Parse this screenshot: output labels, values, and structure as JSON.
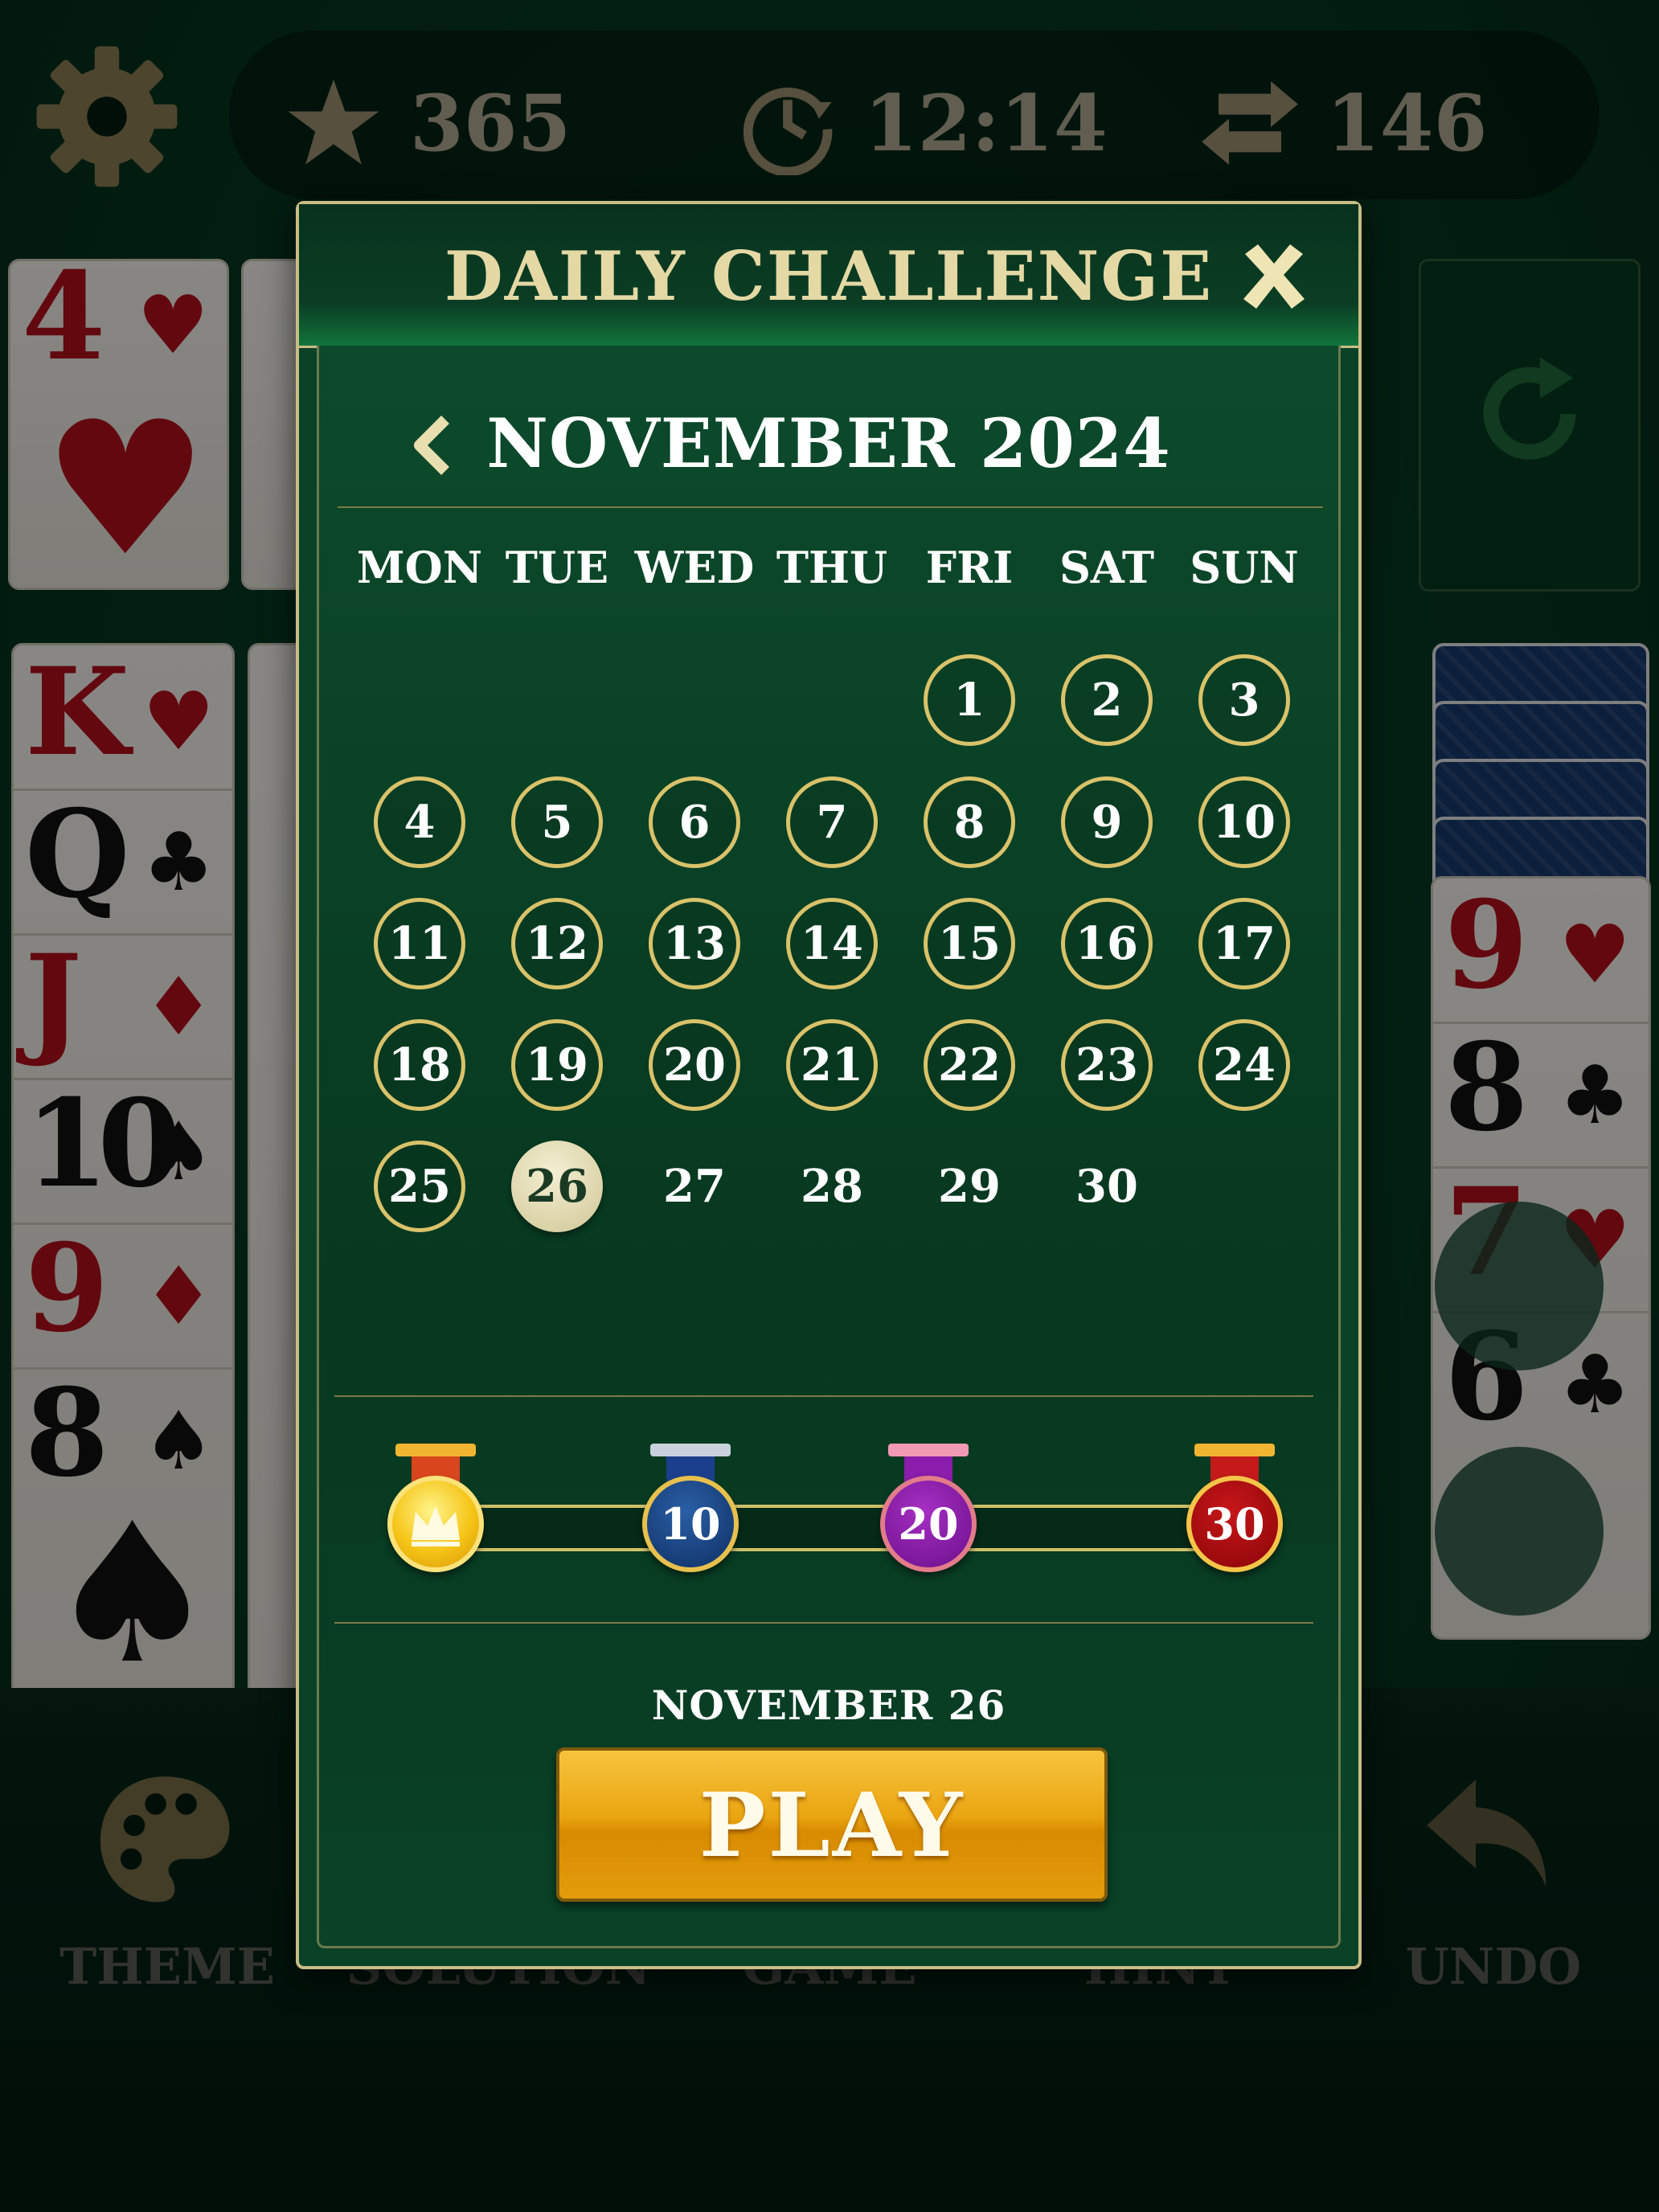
{
  "stats": {
    "stars": "365",
    "time": "12:14",
    "moves": "146"
  },
  "toolbar": {
    "theme_label": "THEME",
    "solution_label": "SOLUTION",
    "game_label": "GAME",
    "hint_label": "HINT",
    "undo_label": "UNDO"
  },
  "cards": {
    "left_col1": [
      {
        "rank": "4",
        "suit": "♥"
      },
      {
        "rank": "K",
        "suit": "♥"
      },
      {
        "rank": "Q",
        "suit": "♣"
      },
      {
        "rank": "J",
        "suit": "♦"
      },
      {
        "rank": "10",
        "suit": "♠"
      },
      {
        "rank": "9",
        "suit": "♦"
      },
      {
        "rank": "8",
        "suit": "♠"
      }
    ],
    "right_col": [
      {
        "rank": "9",
        "suit": "♥"
      },
      {
        "rank": "8",
        "suit": "♣"
      },
      {
        "rank": "7",
        "suit": "♥"
      },
      {
        "rank": "6",
        "suit": "♣"
      }
    ]
  },
  "modal": {
    "title": "DAILY CHALLENGE",
    "month": "NOVEMBER 2024",
    "weekdays": [
      "MON",
      "TUE",
      "WED",
      "THU",
      "FRI",
      "SAT",
      "SUN"
    ],
    "first_weekday_index": 4,
    "days_in_month": 30,
    "completed_through": 25,
    "selected_day": 26,
    "milestones": [
      "",
      "10",
      "20",
      "30"
    ],
    "selected_date_label": "NOVEMBER 26",
    "play_label": "PLAY"
  },
  "colors": {
    "felt": "#0a4227",
    "gold": "#d9c26a",
    "play": "#eaa511"
  }
}
